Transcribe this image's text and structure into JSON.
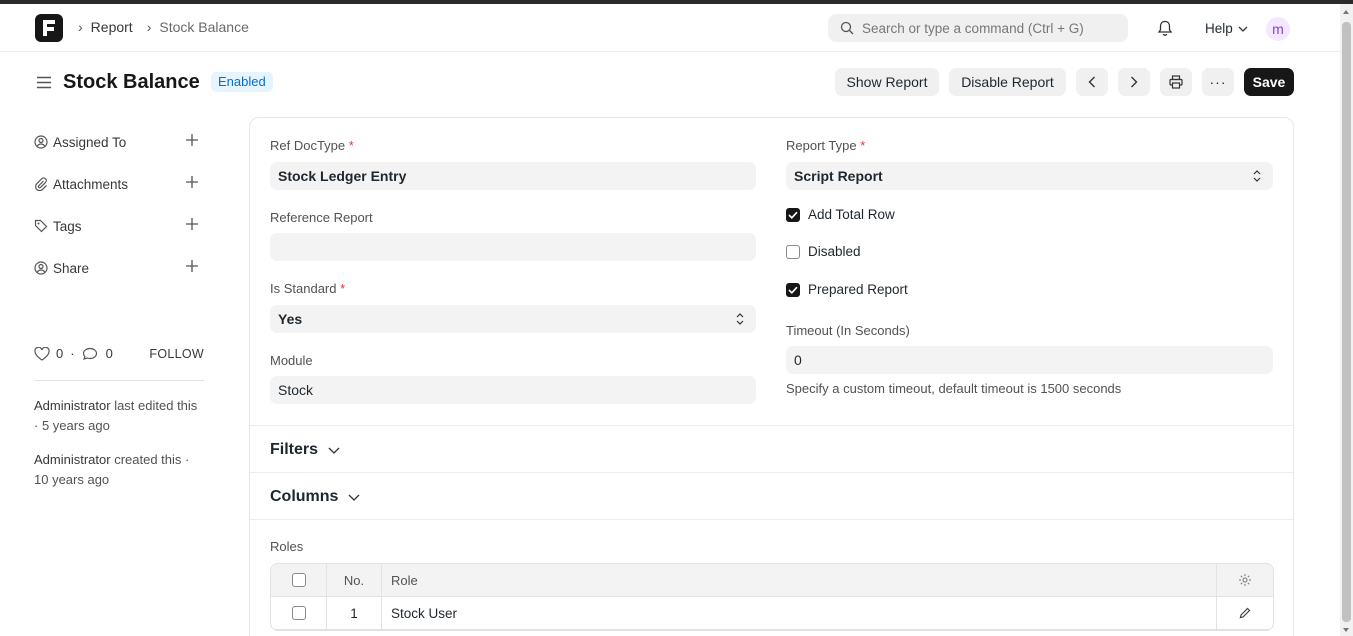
{
  "breadcrumbs": [
    "Report",
    "Stock Balance"
  ],
  "search": {
    "placeholder": "Search or type a command (Ctrl + G)"
  },
  "navbar": {
    "help_label": "Help",
    "avatar_initial": "m"
  },
  "page": {
    "title": "Stock Balance",
    "status": "Enabled",
    "buttons": {
      "show_report": "Show Report",
      "disable_report": "Disable Report",
      "more": "···",
      "save": "Save"
    }
  },
  "sidebar": {
    "items": [
      {
        "label": "Assigned To"
      },
      {
        "label": "Attachments"
      },
      {
        "label": "Tags"
      },
      {
        "label": "Share"
      }
    ],
    "likes": "0",
    "comments": "0",
    "dot": "·",
    "follow": "FOLLOW",
    "activity": [
      {
        "user": "Administrator",
        "text": " last edited this · 5 years ago"
      },
      {
        "user": "Administrator",
        "text": " created this · 10 years ago"
      }
    ]
  },
  "form": {
    "ref_doctype": {
      "label": "Ref DocType",
      "value": "Stock Ledger Entry"
    },
    "reference_report": {
      "label": "Reference Report",
      "value": ""
    },
    "is_standard": {
      "label": "Is Standard",
      "value": "Yes"
    },
    "module": {
      "label": "Module",
      "value": "Stock"
    },
    "report_type": {
      "label": "Report Type",
      "value": "Script Report"
    },
    "add_total_row": {
      "label": "Add Total Row",
      "checked": true
    },
    "disabled": {
      "label": "Disabled",
      "checked": false
    },
    "prepared_report": {
      "label": "Prepared Report",
      "checked": true
    },
    "timeout": {
      "label": "Timeout (In Seconds)",
      "value": "0",
      "help": "Specify a custom timeout, default timeout is 1500 seconds"
    },
    "required_mark": "*"
  },
  "sections": {
    "filters": "Filters",
    "columns": "Columns"
  },
  "roles": {
    "label": "Roles",
    "headers": {
      "no": "No.",
      "role": "Role"
    },
    "rows": [
      {
        "no": "1",
        "role": "Stock User"
      }
    ]
  },
  "colors": {
    "accent": "#171717",
    "badge_bg": "#e6f4ff",
    "badge_text": "#0070cc",
    "required": "#e03636"
  }
}
